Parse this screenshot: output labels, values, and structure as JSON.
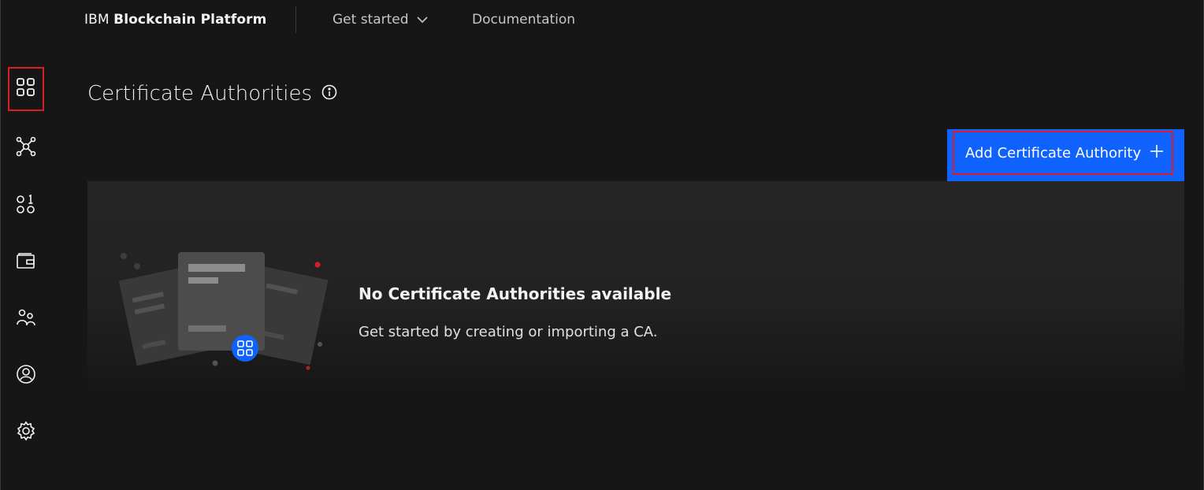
{
  "header": {
    "brand_prefix": "IBM",
    "brand_name": "Blockchain Platform",
    "nav_get_started": "Get started",
    "nav_documentation": "Documentation"
  },
  "sidebar": {
    "items": [
      {
        "icon": "nodes-grid-icon",
        "active": true
      },
      {
        "icon": "channels-network-icon",
        "active": false
      },
      {
        "icon": "smart-contracts-icon",
        "active": false
      },
      {
        "icon": "wallet-icon",
        "active": false
      },
      {
        "icon": "users-icon",
        "active": false
      },
      {
        "icon": "user-profile-icon",
        "active": false
      },
      {
        "icon": "settings-gear-icon",
        "active": false
      }
    ]
  },
  "main": {
    "title": "Certificate Authorities",
    "add_button_label": "Add Certificate Authority",
    "empty_title": "No Certificate Authorities available",
    "empty_subtitle": "Get started by creating or importing a CA."
  },
  "colors": {
    "background": "#161616",
    "accent_blue": "#0f62fe",
    "highlight_red": "#da1e28",
    "panel": "#262626"
  }
}
